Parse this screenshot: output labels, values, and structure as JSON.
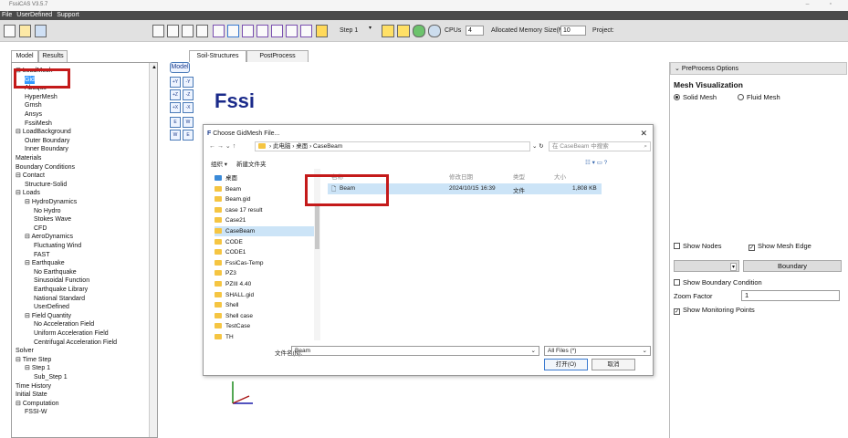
{
  "app": {
    "title": "FssiCAS V3.5.7"
  },
  "menu": [
    "File",
    "UserDefined",
    "Support"
  ],
  "toolbar": {
    "step": "Step 1",
    "cpus_label": "CPUs",
    "cpus_value": "4",
    "memory_label": "Allocated Memory Size(MB) :",
    "memory_value": "10",
    "project_label": "Project:"
  },
  "left_tabs": [
    "Model",
    "Results"
  ],
  "center_tabs": [
    "Soil-Structures",
    "PostProcess"
  ],
  "tree": [
    {
      "label": "LoadMesh",
      "depth": 0,
      "exp": "⊟"
    },
    {
      "label": "Gid",
      "depth": 1,
      "sel": true
    },
    {
      "label": "Abaqus",
      "depth": 1
    },
    {
      "label": "HyperMesh",
      "depth": 1
    },
    {
      "label": "Gmsh",
      "depth": 1
    },
    {
      "label": "Ansys",
      "depth": 1
    },
    {
      "label": "FssiMesh",
      "depth": 1
    },
    {
      "label": "LoadBackground",
      "depth": 0,
      "exp": "⊟"
    },
    {
      "label": "Outer Boundary",
      "depth": 1
    },
    {
      "label": "Inner Boundary",
      "depth": 1
    },
    {
      "label": "Materials",
      "depth": 0
    },
    {
      "label": "Boundary Conditions",
      "depth": 0
    },
    {
      "label": "Contact",
      "depth": 0,
      "exp": "⊟"
    },
    {
      "label": "Structure-Solid",
      "depth": 1
    },
    {
      "label": "Loads",
      "depth": 0,
      "exp": "⊟"
    },
    {
      "label": "HydroDynamics",
      "depth": 1,
      "exp": "⊟"
    },
    {
      "label": "No Hydro",
      "depth": 2
    },
    {
      "label": "Stokes Wave",
      "depth": 2
    },
    {
      "label": "CFD",
      "depth": 2
    },
    {
      "label": "AeroDynamics",
      "depth": 1,
      "exp": "⊟"
    },
    {
      "label": "Fluctuating Wind",
      "depth": 2
    },
    {
      "label": "FAST",
      "depth": 2
    },
    {
      "label": "Earthquake",
      "depth": 1,
      "exp": "⊟"
    },
    {
      "label": "No Earthquake",
      "depth": 2
    },
    {
      "label": "Sinusoidal Function",
      "depth": 2
    },
    {
      "label": "Earthquake Library",
      "depth": 2
    },
    {
      "label": "National Standard",
      "depth": 2
    },
    {
      "label": "UserDefined",
      "depth": 2
    },
    {
      "label": "Field Quantity",
      "depth": 1,
      "exp": "⊟"
    },
    {
      "label": "No Acceleration Field",
      "depth": 2
    },
    {
      "label": "Uniform Acceleration Field",
      "depth": 2
    },
    {
      "label": "Centrifugal Acceleration Field",
      "depth": 2
    },
    {
      "label": "Solver",
      "depth": 0
    },
    {
      "label": "Time Step",
      "depth": 0,
      "exp": "⊟"
    },
    {
      "label": "Step 1",
      "depth": 1,
      "exp": "⊟"
    },
    {
      "label": "Sub_Step 1",
      "depth": 2
    },
    {
      "label": "Time History",
      "depth": 0
    },
    {
      "label": "Initial State",
      "depth": 0
    },
    {
      "label": "Computation",
      "depth": 0,
      "exp": "⊟"
    },
    {
      "label": "FSSI-W",
      "depth": 1
    }
  ],
  "canvas": {
    "logo": "Fssi",
    "model_label": "Model"
  },
  "dialog": {
    "title": "Choose GidMesh File...",
    "path": [
      "此电脑",
      "桌面",
      "CaseBeam"
    ],
    "search_placeholder": "在 CaseBeam 中搜索",
    "organize": "组织 ▾",
    "new_folder": "新建文件夹",
    "columns": [
      "名称",
      "修改日期",
      "类型",
      "大小"
    ],
    "nav_items": [
      "桌面",
      "Beam",
      "Beam.gid",
      "case 17 result",
      "Case21",
      "CaseBeam",
      "CODE",
      "CODE1",
      "FssiCas-Temp",
      "PZ3",
      "PZIII 4.40",
      "SHALL.gid",
      "Shell",
      "Shell case",
      "TestCase",
      "TH"
    ],
    "file": {
      "name": "Beam",
      "date": "2024/10/15 16:39",
      "type": "文件",
      "size": "1,808 KB"
    },
    "filename_label": "文件名(N):",
    "filename_value": "Beam",
    "filter": "All Files (*)",
    "open": "打开(O)",
    "cancel": "取消"
  },
  "right": {
    "header": "PreProcess Options",
    "section": "Mesh Visualization",
    "solid": "Solid Mesh",
    "fluid": "Fluid Mesh",
    "show_nodes": "Show Nodes",
    "show_edge": "Show Mesh Edge",
    "boundary_btn": "Boundary",
    "show_bc": "Show Boundary Condition",
    "zoom_label": "Zoom Factor",
    "zoom_value": "1",
    "show_monitor": "Show Monitoring Points"
  },
  "colors": {
    "highlight": "#c41a1a",
    "selection": "#3399ff",
    "menubar": "#4a4a4a"
  }
}
